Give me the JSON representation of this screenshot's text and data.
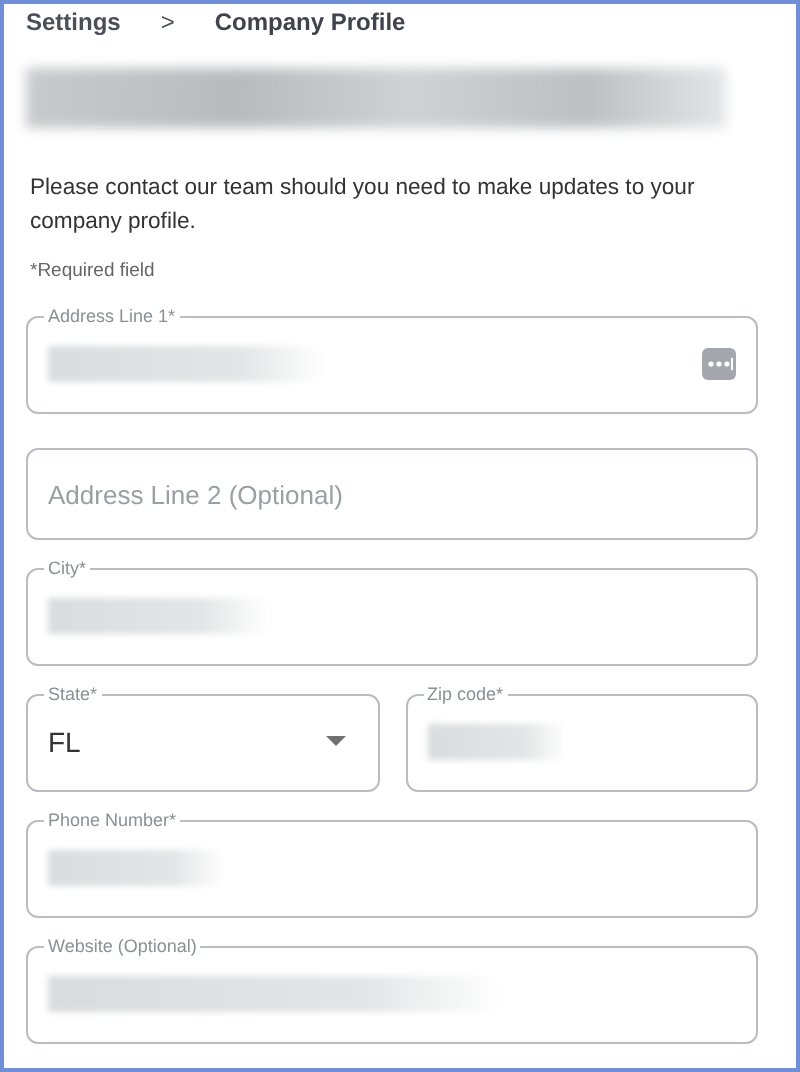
{
  "breadcrumb": [
    {
      "label": "Settings",
      "kind": "link"
    },
    {
      "label": ">",
      "kind": "separator"
    },
    {
      "label": "Company Profile",
      "kind": "current"
    }
  ],
  "company_name": {
    "redacted": true
  },
  "notice": "Please contact our team should you need to make updates to your company profile.",
  "required_note": "*Required field",
  "rows": [
    [
      {
        "kind": "text",
        "label": "Address Line 1*",
        "redacted": true,
        "menu_icon": true
      }
    ],
    [
      {
        "kind": "text",
        "placeholder": "Address Line 2 (Optional)"
      }
    ],
    [
      {
        "kind": "text",
        "label": "City*",
        "redacted": true,
        "menu_icon": false
      }
    ],
    [
      {
        "kind": "select",
        "label": "State*",
        "value": "FL"
      },
      {
        "kind": "text",
        "label": "Zip code*",
        "redacted": true,
        "menu_icon": false
      }
    ],
    [
      {
        "kind": "text",
        "label": "Phone Number*",
        "redacted": true,
        "menu_icon": false
      }
    ],
    [
      {
        "kind": "text",
        "label": "Website (Optional)",
        "redacted": true,
        "menu_icon": false
      }
    ]
  ]
}
